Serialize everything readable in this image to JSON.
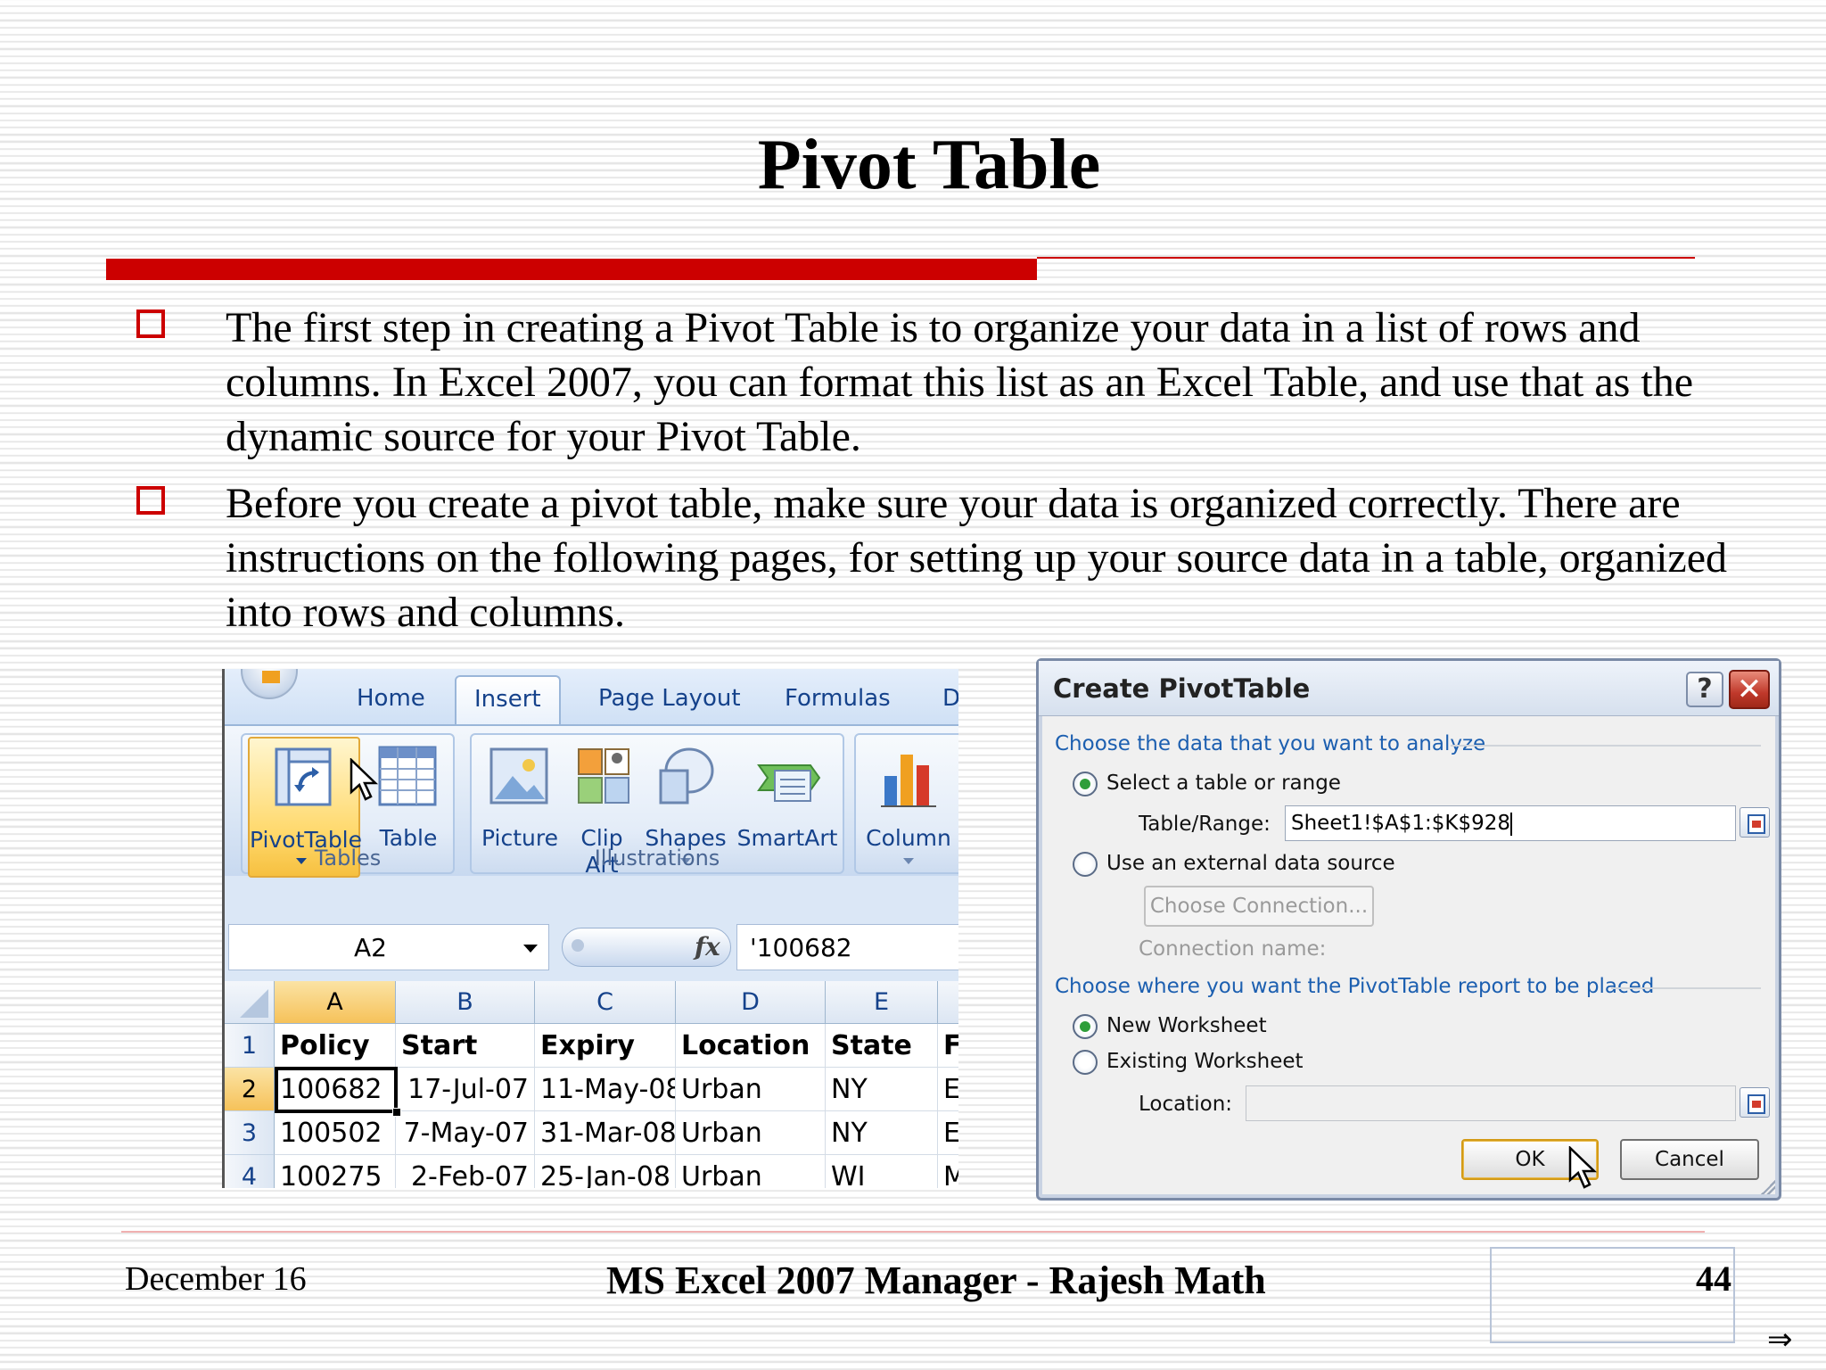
{
  "slide": {
    "title": "Pivot Table",
    "bullets": [
      "The first step in creating a Pivot Table is to organize your data in a list of rows and columns. In Excel 2007, you can format this list as an Excel Table, and use that as the dynamic source for your Pivot Table.",
      "Before you create a pivot table, make sure your data is organized correctly. There are instructions on the following pages, for setting up your source data in a table, organized into rows and columns."
    ],
    "footer": {
      "date": "December 16",
      "center": "MS Excel 2007 Manager - Rajesh Math",
      "page_number": "44",
      "nav_arrow": "⇒"
    },
    "colors": {
      "accent_red": "#cc0000"
    }
  },
  "excel": {
    "tabs": [
      "Home",
      "Insert",
      "Page Layout",
      "Formulas",
      "D"
    ],
    "active_tab": "Insert",
    "groups": {
      "tables": {
        "label": "Tables",
        "buttons": [
          {
            "label": "PivotTable",
            "icon": "pivottable-icon",
            "has_dropdown": true,
            "highlighted": true
          },
          {
            "label": "Table",
            "icon": "table-icon"
          }
        ]
      },
      "illustrations": {
        "label": "Illustrations",
        "buttons": [
          {
            "label": "Picture",
            "icon": "picture-icon"
          },
          {
            "label": "Clip",
            "label2": "Art",
            "icon": "clip-art-icon"
          },
          {
            "label": "Shapes",
            "icon": "shapes-icon",
            "has_dropdown": true
          },
          {
            "label": "SmartArt",
            "icon": "smartart-icon"
          }
        ]
      },
      "charts": {
        "buttons": [
          {
            "label": "Column",
            "icon": "column-chart-icon",
            "has_dropdown": true
          }
        ]
      }
    },
    "name_box": "A2",
    "fx_symbol": "fx",
    "formula": "'100682",
    "columns": [
      "A",
      "B",
      "C",
      "D",
      "E"
    ],
    "selected_column": "A",
    "rows": [
      {
        "num": "1",
        "cells": [
          "Policy",
          "Start",
          "Expiry",
          "Location",
          "State",
          "F"
        ]
      },
      {
        "num": "2",
        "cells": [
          "100682",
          "17-Jul-07",
          "11-May-08",
          "Urban",
          "NY",
          "E"
        ]
      },
      {
        "num": "3",
        "cells": [
          "100502",
          "7-May-07",
          "31-Mar-08",
          "Urban",
          "NY",
          "E"
        ]
      },
      {
        "num": "4",
        "cells": [
          "100275",
          "2-Feb-07",
          "25-Jan-08",
          "Urban",
          "WI",
          "M"
        ]
      }
    ]
  },
  "dialog": {
    "title": "Create PivotTable",
    "help": "?",
    "close": "✕",
    "section1": "Choose the data that you want to analyze",
    "opt_select_range": "Select a table or range",
    "table_range_label": "Table/Range:",
    "table_range_value": "Sheet1!$A$1:$K$928",
    "opt_external": "Use an external data source",
    "choose_connection": "Choose Connection...",
    "connection_name_label": "Connection name:",
    "section2": "Choose where you want the PivotTable report to be placed",
    "opt_new_ws": "New Worksheet",
    "opt_existing_ws": "Existing Worksheet",
    "location_label": "Location:",
    "location_value": "",
    "ok": "OK",
    "cancel": "Cancel",
    "selected_source": "select_range",
    "selected_destination": "new_worksheet"
  }
}
